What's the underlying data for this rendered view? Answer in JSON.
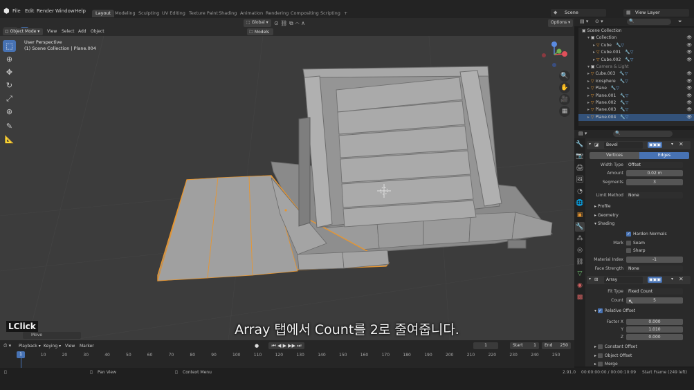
{
  "topbar": {
    "menus": [
      "File",
      "Edit",
      "Render",
      "Window",
      "Help"
    ],
    "workspaces": [
      "Layout",
      "Modeling",
      "Sculpting",
      "UV Editing",
      "Texture Paint",
      "Shading",
      "Animation",
      "Rendering",
      "Compositing",
      "Scripting"
    ],
    "active_workspace": "Layout",
    "add_tab": "+",
    "scene": "Scene",
    "view_layer": "View Layer"
  },
  "viewport_header": {
    "mode": "Object Mode",
    "menus": [
      "View",
      "Select",
      "Add",
      "Object"
    ],
    "orientation": "Global",
    "models": "Models",
    "options": "Options"
  },
  "viewport": {
    "view_name": "User Perspective",
    "collection_path": "(1) Scene Collection | Plane.004"
  },
  "outliner": {
    "root": "Scene Collection",
    "rows": [
      {
        "name": "Collection",
        "indent": 1,
        "sel": false
      },
      {
        "name": "Cube",
        "indent": 2,
        "sel": false
      },
      {
        "name": "Cube.001",
        "indent": 2,
        "sel": false
      },
      {
        "name": "Cube.002",
        "indent": 2,
        "sel": false
      },
      {
        "name": "Camera & Light",
        "indent": 1,
        "sel": false
      },
      {
        "name": "Cube.003",
        "indent": 1,
        "sel": false
      },
      {
        "name": "Icosphere",
        "indent": 1,
        "sel": false
      },
      {
        "name": "Plane",
        "indent": 1,
        "sel": false
      },
      {
        "name": "Plane.001",
        "indent": 1,
        "sel": false
      },
      {
        "name": "Plane.002",
        "indent": 1,
        "sel": false
      },
      {
        "name": "Plane.003",
        "indent": 1,
        "sel": false
      },
      {
        "name": "Plane.004",
        "indent": 1,
        "sel": true
      }
    ]
  },
  "properties": {
    "bevel": {
      "name": "Bevel",
      "tab_vertices": "Vertices",
      "tab_edges": "Edges",
      "width_type_label": "Width Type",
      "width_type": "Offset",
      "amount_label": "Amount",
      "amount": "0.02 m",
      "segments_label": "Segments",
      "segments": "3",
      "limit_method_label": "Limit Method",
      "limit_method": "None",
      "profile": "Profile",
      "geometry": "Geometry",
      "shading": "Shading",
      "harden_normals": "Harden Normals",
      "mark_label": "Mark",
      "seam": "Seam",
      "sharp": "Sharp",
      "material_index_label": "Material Index",
      "material_index": "-1",
      "face_strength_label": "Face Strength",
      "face_strength": "None"
    },
    "array": {
      "name": "Array",
      "fit_type_label": "Fit Type",
      "fit_type": "Fixed Count",
      "count_label": "Count",
      "count": "5",
      "relative_offset": "Relative Offset",
      "factor_x_label": "Factor X",
      "factor_x": "0.000",
      "y_label": "Y",
      "factor_y": "1.010",
      "z_label": "Z",
      "factor_z": "0.000",
      "constant_offset": "Constant Offset",
      "object_offset": "Object Offset",
      "merge": "Merge"
    }
  },
  "timeline": {
    "menus": [
      "Playback",
      "Keying",
      "View",
      "Marker"
    ],
    "current_frame": "1",
    "start_label": "Start",
    "start": "1",
    "end_label": "End",
    "end": "250",
    "ticks": [
      "0",
      "10",
      "20",
      "30",
      "40",
      "50",
      "60",
      "70",
      "80",
      "90",
      "100",
      "110",
      "120",
      "130",
      "140",
      "150",
      "160",
      "170",
      "180",
      "190",
      "200",
      "210",
      "220",
      "230",
      "240",
      "250"
    ],
    "playhead": "1"
  },
  "statusbar": {
    "pan_view": "Pan View",
    "context_menu": "Context Menu",
    "version": "2.91.0",
    "time": "00:00:00:00 / 00:00:10:09",
    "start_frame": "Start Frame (249 left)"
  },
  "overlay": {
    "lclick": "LClick",
    "move": "Move",
    "subtitle": "Array 탭에서 Count를 2로 줄여줍니다."
  },
  "colors": {
    "accent": "#4772b3",
    "selection_outline": "#e8962f"
  },
  "icons": [
    "select-icon",
    "cursor-icon",
    "move-icon",
    "rotate-icon",
    "scale-icon",
    "transform-icon",
    "annotate-icon",
    "measure-icon",
    "zoom-icon",
    "hand-icon",
    "camera-icon",
    "grid-icon",
    "wrench-icon",
    "eye-icon"
  ]
}
